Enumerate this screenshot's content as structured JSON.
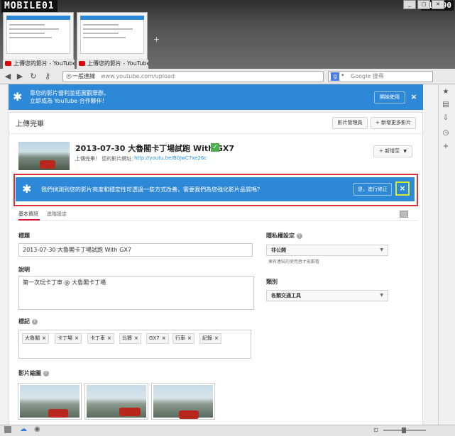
{
  "browser": {
    "logo_text": "MOBILE01",
    "watermark": "#14990",
    "window_controls": [
      "_",
      "□",
      "✕"
    ],
    "tabs": [
      {
        "label": "上傳您的影片 - YouTube"
      },
      {
        "label": "上傳您的影片 - YouTube"
      }
    ],
    "new_tab_label": "+",
    "nav_icons": [
      "back-icon",
      "forward-icon",
      "reload-icon",
      "key-icon"
    ],
    "url_label": "一般連線",
    "url": "www.youtube.com/upload",
    "search_engine_letter": "g",
    "search_placeholder": "Google 搜尋",
    "side_icons": [
      "star-icon",
      "notes-icon",
      "download-icon",
      "history-icon",
      "add-icon"
    ]
  },
  "partner_banner": {
    "line1": "靠您的影片營利並拓展觀眾群。",
    "line2": "立即成為 YouTube 合作夥伴！",
    "start_button": "開始使用",
    "close": "×"
  },
  "header": {
    "title": "上傳完畢",
    "manager_button": "影片管理員",
    "add_more_button": "+ 新增更多影片"
  },
  "video": {
    "title": "2013-07-30 大魯閣卡丁場試跑 With GX7",
    "complete_text": "上傳完畢！ 您的影片網址：",
    "link": "http://youtu.be/B0JwC7xe26c",
    "add_to_button": "+ 新增至"
  },
  "enhance_banner": {
    "message": "我們偵測到您的影片亮度和穩定性可透過一些方式改善，需要我們為您強化影片品質嗎？",
    "yes_button": "是，進行修正",
    "close": "×"
  },
  "tabs": {
    "basic": "基本資訊",
    "advanced": "進階設定"
  },
  "form": {
    "title_label": "標題",
    "title_value": "2013-07-30 大魯閣卡丁場試跑 With GX7",
    "desc_label": "說明",
    "desc_value": "第一次玩卡丁車 @ 大魯閣卡丁場",
    "tags_label": "標記",
    "tags": [
      "大魯閣",
      "卡丁場",
      "卡丁車",
      "比賽",
      "GX7",
      "行車",
      "紀錄"
    ],
    "tag_remove": "×",
    "privacy_label": "隱私權設定",
    "privacy_value": "非公開",
    "privacy_hint": "擁有連結的使用者才能觀看",
    "category_label": "類別",
    "category_value": "各類交通工具",
    "thumbnails_label": "影片縮圖",
    "help": "?"
  }
}
